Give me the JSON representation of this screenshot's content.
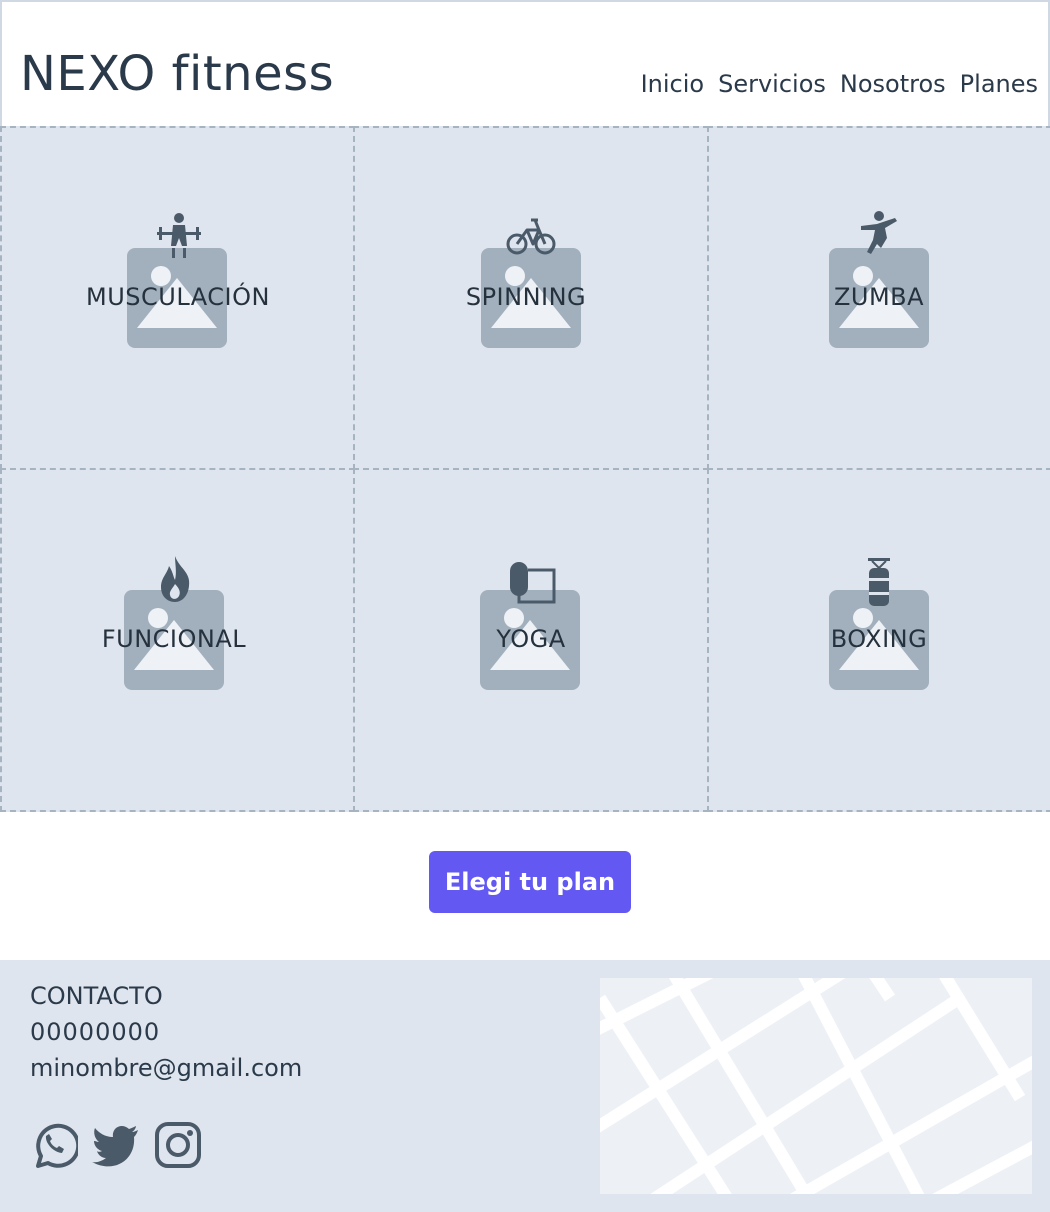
{
  "header": {
    "brand": "NEXO fitness",
    "nav": [
      "Inicio",
      "Servicios",
      "Nosotros",
      "Planes"
    ]
  },
  "activities": [
    {
      "label": "MUSCULACIÓN",
      "icon": "weightlifting-icon"
    },
    {
      "label": "SPINNING",
      "icon": "bicycle-icon"
    },
    {
      "label": "ZUMBA",
      "icon": "dancing-icon"
    },
    {
      "label": "FUNCIONAL",
      "icon": "fire-icon"
    },
    {
      "label": "YOGA",
      "icon": "yoga-mat-icon"
    },
    {
      "label": "BOXING",
      "icon": "punching-bag-icon"
    }
  ],
  "cta": {
    "label": "Elegi tu plan"
  },
  "footer": {
    "contact_title": "CONTACTO",
    "phone": "00000000",
    "email": "minombre@gmail.com",
    "social": [
      "whatsapp-icon",
      "twitter-icon",
      "instagram-icon"
    ],
    "map": "map-placeholder"
  },
  "colors": {
    "primary": "#6358f2",
    "text": "#2b3a4a",
    "panel": "#dfe5ee",
    "placeholder": "#a2b0bd",
    "icon": "#4b5a69"
  }
}
